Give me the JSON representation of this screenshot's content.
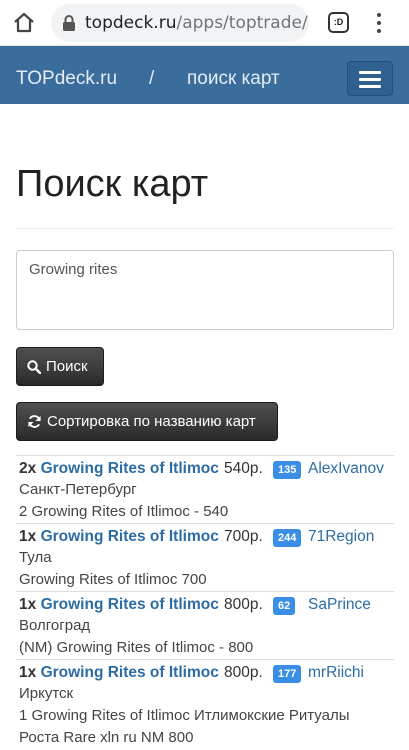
{
  "browser": {
    "url_host": "topdeck.ru",
    "url_path": "/apps/toptrade/si",
    "ext_label": ":D"
  },
  "navbar": {
    "brand": "TOPdeck.ru",
    "separator": "/",
    "crumb": "поиск карт"
  },
  "page": {
    "title": "Поиск карт",
    "search_value": "Growing rites",
    "search_button": "Поиск",
    "sort_button": "Сортировка по названию карт"
  },
  "colors": {
    "navbar": "#3a6d9c",
    "link": "#2d6ca2",
    "badge": "#3a8ee6"
  },
  "results": [
    {
      "qty": "2x",
      "card": "Growing Rites of Itlimoc",
      "price": "540р.",
      "badge": "135",
      "user": "AlexIvanov",
      "city": "Санкт-Петербург",
      "desc": "2 Growing Rites of Itlimoc - 540"
    },
    {
      "qty": "1x",
      "card": "Growing Rites of Itlimoc",
      "price": "700р.",
      "badge": "244",
      "user": "71Region",
      "city": "Тула",
      "desc": "Growing Rites of Itlimoc 700"
    },
    {
      "qty": "1x",
      "card": "Growing Rites of Itlimoc",
      "price": "800р.",
      "badge": "62",
      "user": "SaPrince",
      "city": "Волгоград",
      "desc": "(NM) Growing Rites of Itlimoc - 800"
    },
    {
      "qty": "1x",
      "card": "Growing Rites of Itlimoc",
      "price": "800р.",
      "badge": "177",
      "user": "mrRiichi",
      "city": "Иркутск",
      "desc": "1 Growing Rites of Itlimoc Итлимокские Ритуалы Роста Rare xln ru NM 800"
    }
  ]
}
